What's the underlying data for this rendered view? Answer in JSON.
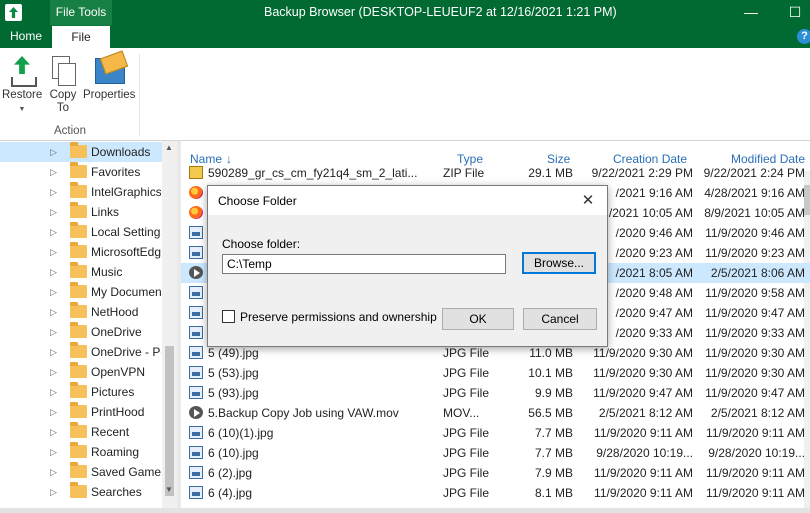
{
  "window": {
    "context_tab": "File Tools",
    "title": "Backup Browser (DESKTOP-LEUEUF2 at 12/16/2021 1:21 PM)",
    "minimize_glyph": "—",
    "maximize_glyph": "☐"
  },
  "tabs": {
    "home": "Home",
    "file": "File",
    "help": "?"
  },
  "ribbon": {
    "restore": "Restore",
    "copy_to": "Copy To",
    "properties": "Properties",
    "group_label": "Action",
    "dropdown_glyph": "▼"
  },
  "tree": {
    "items": [
      {
        "label": "Downloads",
        "selected": true
      },
      {
        "label": "Favorites"
      },
      {
        "label": "IntelGraphics"
      },
      {
        "label": "Links"
      },
      {
        "label": "Local Settings"
      },
      {
        "label": "MicrosoftEdge"
      },
      {
        "label": "Music"
      },
      {
        "label": "My Documents"
      },
      {
        "label": "NetHood"
      },
      {
        "label": "OneDrive"
      },
      {
        "label": "OneDrive - Pe"
      },
      {
        "label": "OpenVPN"
      },
      {
        "label": "Pictures"
      },
      {
        "label": "PrintHood"
      },
      {
        "label": "Recent"
      },
      {
        "label": "Roaming"
      },
      {
        "label": "Saved Games"
      },
      {
        "label": "Searches"
      }
    ],
    "expander_glyph": "▷",
    "scroll_up": "▲",
    "scroll_down": "▼"
  },
  "list": {
    "columns": {
      "name": "Name",
      "type": "Type",
      "size": "Size",
      "created": "Creation Date",
      "modified": "Modified Date"
    },
    "sort_glyph": "↓",
    "rows": [
      {
        "icon": "zip",
        "name": "590289_gr_cs_cm_fy21q4_sm_2_lati...",
        "type": "ZIP File",
        "size": "29.1 MB",
        "created": "9/22/2021 2:29 PM",
        "modified": "9/22/2021 2:24 PM"
      },
      {
        "icon": "firefox",
        "name": "",
        "type": "",
        "size": "",
        "created": "/2021 9:16 AM",
        "modified": "4/28/2021 9:16 AM"
      },
      {
        "icon": "firefox",
        "name": "",
        "type": "",
        "size": "",
        "created": "/2021 10:05 AM",
        "modified": "8/9/2021 10:05 AM"
      },
      {
        "icon": "image",
        "name": "",
        "type": "",
        "size": "",
        "created": "/2020 9:46 AM",
        "modified": "11/9/2020 9:46 AM"
      },
      {
        "icon": "image",
        "name": "",
        "type": "",
        "size": "",
        "created": "/2020 9:23 AM",
        "modified": "11/9/2020 9:23 AM"
      },
      {
        "icon": "movie",
        "name": "",
        "type": "",
        "size": "",
        "created": "/2021 8:05 AM",
        "modified": "2/5/2021 8:06 AM",
        "highlight": true
      },
      {
        "icon": "image",
        "name": "",
        "type": "",
        "size": "",
        "created": "/2020 9:48 AM",
        "modified": "11/9/2020 9:58 AM"
      },
      {
        "icon": "image",
        "name": "",
        "type": "",
        "size": "",
        "created": "/2020 9:47 AM",
        "modified": "11/9/2020 9:47 AM"
      },
      {
        "icon": "image",
        "name": "",
        "type": "",
        "size": "",
        "created": "/2020 9:33 AM",
        "modified": "11/9/2020 9:33 AM"
      },
      {
        "icon": "image",
        "name": "5 (49).jpg",
        "type": "JPG File",
        "size": "11.0 MB",
        "created": "11/9/2020 9:30 AM",
        "modified": "11/9/2020 9:30 AM"
      },
      {
        "icon": "image",
        "name": "5 (53).jpg",
        "type": "JPG File",
        "size": "10.1 MB",
        "created": "11/9/2020 9:30 AM",
        "modified": "11/9/2020 9:30 AM"
      },
      {
        "icon": "image",
        "name": "5 (93).jpg",
        "type": "JPG File",
        "size": "9.9 MB",
        "created": "11/9/2020 9:47 AM",
        "modified": "11/9/2020 9:47 AM"
      },
      {
        "icon": "movie",
        "name": "5.Backup Copy Job using VAW.mov",
        "type": "MOV...",
        "size": "56.5 MB",
        "created": "2/5/2021 8:12 AM",
        "modified": "2/5/2021 8:12 AM"
      },
      {
        "icon": "image",
        "name": "6 (10)(1).jpg",
        "type": "JPG File",
        "size": "7.7 MB",
        "created": "11/9/2020 9:11 AM",
        "modified": "11/9/2020 9:11 AM"
      },
      {
        "icon": "image",
        "name": "6 (10).jpg",
        "type": "JPG File",
        "size": "7.7 MB",
        "created": "9/28/2020 10:19...",
        "modified": "9/28/2020 10:19..."
      },
      {
        "icon": "image",
        "name": "6 (2).jpg",
        "type": "JPG File",
        "size": "7.9 MB",
        "created": "11/9/2020 9:11 AM",
        "modified": "11/9/2020 9:11 AM"
      },
      {
        "icon": "image",
        "name": "6 (4).jpg",
        "type": "JPG File",
        "size": "8.1 MB",
        "created": "11/9/2020 9:11 AM",
        "modified": "11/9/2020 9:11 AM"
      }
    ]
  },
  "dialog": {
    "title": "Choose Folder",
    "close_glyph": "✕",
    "folder_label": "Choose folder:",
    "folder_value": "C:\\Temp",
    "browse_label": "Browse...",
    "preserve_label": "Preserve permissions and ownership",
    "preserve_checked": false,
    "ok_label": "OK",
    "cancel_label": "Cancel"
  },
  "colors": {
    "accent_green": "#006a32",
    "selection": "#cce8ff",
    "header_blue": "#2a6fb5"
  }
}
